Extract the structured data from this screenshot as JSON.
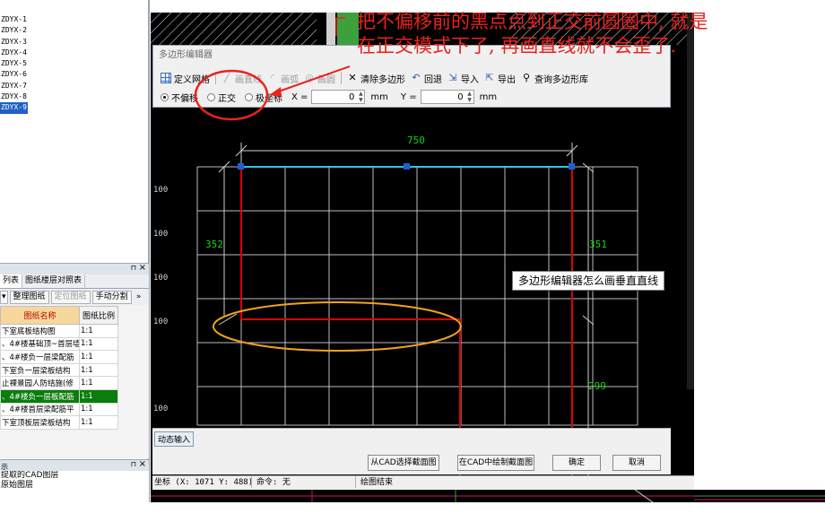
{
  "left_list": {
    "items": [
      "ZDYX-1",
      "ZDYX-2",
      "ZDYX-3",
      "ZDYX-4",
      "ZDYX-5",
      "ZDYX-6",
      "ZDYX-7",
      "ZDYX-8",
      "ZDYX-9"
    ],
    "selected_index": 8
  },
  "drawing_panel": {
    "tabs": [
      "列表",
      "图纸楼层对照表"
    ],
    "toolbar": [
      "整理图纸",
      "定位图纸",
      "手动分割"
    ],
    "more": "»",
    "pin": "⊓",
    "close": "×",
    "headers": [
      "图纸名称",
      "图纸比例"
    ],
    "rows": [
      {
        "name": "下室底板结构图",
        "scale": "1:1"
      },
      {
        "name": "、4#楼基础顶~首层墙",
        "scale": "1:1"
      },
      {
        "name": "、4#楼负一层梁配筋",
        "scale": "1:1"
      },
      {
        "name": "下室负一层梁板结构",
        "scale": "1:1"
      },
      {
        "name": "止裸景园人防结施(修",
        "scale": "1:1"
      },
      {
        "name": "、4#楼负一层板配筋",
        "scale": "1:1"
      },
      {
        "name": "、4#楼首层梁配筋平",
        "scale": "1:1"
      },
      {
        "name": "下室顶板层梁板结构",
        "scale": "1:1"
      }
    ],
    "selected_row": 5
  },
  "layer_panel": {
    "title": "示",
    "items": [
      "提取的CAD图层",
      "原始图层"
    ]
  },
  "dialog": {
    "title": "多边形编辑器",
    "toolbar": [
      {
        "label": "定义网格",
        "icon": "grid-icon",
        "enabled": true
      },
      {
        "label": "画直线",
        "icon": "line-icon",
        "enabled": false
      },
      {
        "label": "画弧",
        "icon": "arc-icon",
        "enabled": false
      },
      {
        "label": "画圆",
        "icon": "circle-icon",
        "enabled": false
      },
      {
        "label": "清除多边形",
        "icon": "clear-icon",
        "enabled": true
      },
      {
        "label": "回退",
        "icon": "undo-icon",
        "enabled": true
      },
      {
        "label": "导入",
        "icon": "import-icon",
        "enabled": true
      },
      {
        "label": "导出",
        "icon": "export-icon",
        "enabled": true
      },
      {
        "label": "查询多边形库",
        "icon": "search-icon",
        "enabled": true
      }
    ],
    "modes": [
      "不偏移",
      "正交",
      "极坐标"
    ],
    "mode_selected": 0,
    "x_label": "X =",
    "x_value": "0",
    "y_label": "Y =",
    "y_value": "0",
    "unit": "mm"
  },
  "cad": {
    "dimensions": {
      "top": "750",
      "left": "352",
      "right_upper": "351",
      "right_lower": "299"
    },
    "axis_labels": [
      "100",
      "100",
      "100",
      "100",
      "100"
    ],
    "colors": {
      "background": "#000000",
      "polyline": "#e00000",
      "top_edge": "#2ec4e0",
      "grid": "#c8c8c8",
      "dim_text": "#19d219",
      "vertex": "#1f5fd0"
    }
  },
  "annotation": {
    "line1": "把不偏移前的黑点点到正交前圆圈中, 就是",
    "line2": "在正交模式下了, 再画直线就不会歪了.",
    "color": "#e8231e"
  },
  "tooltip": "多边形编辑器怎么画垂直直线",
  "bottom": {
    "dynamic_input": "动态输入",
    "buttons": [
      "从CAD选择截面图",
      "在CAD中绘制截面图",
      "确定",
      "取消"
    ]
  },
  "statusbar": {
    "coords": "坐标 (X: 1071 Y: 488)",
    "command": "命令: 无",
    "status": "绘图结束"
  }
}
